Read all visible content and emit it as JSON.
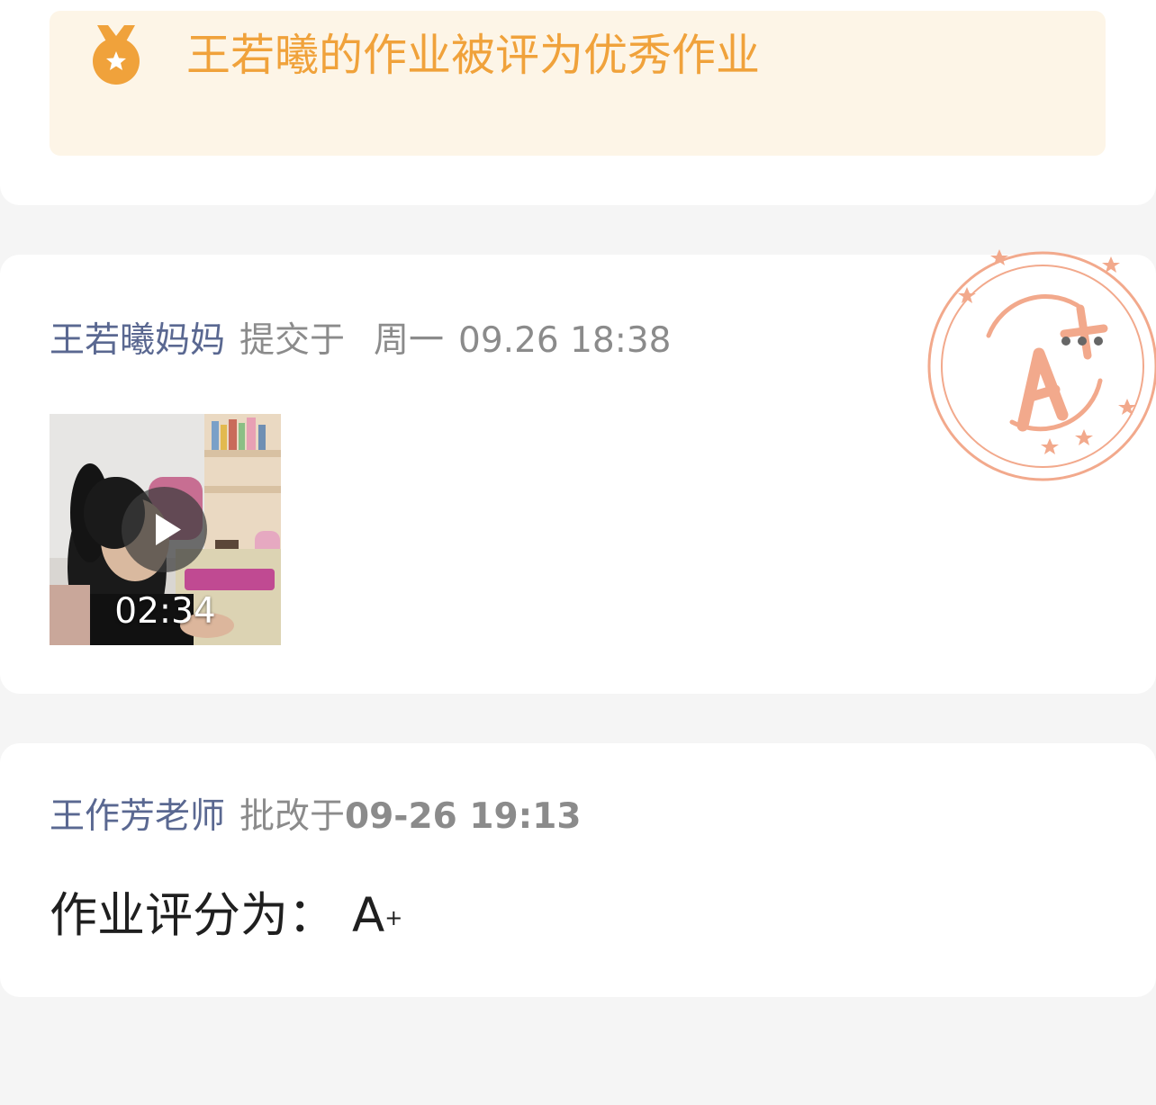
{
  "colors": {
    "page_bg": "#f5f5f5",
    "card_bg": "#ffffff",
    "banner_bg": "#fdf5e7",
    "accent_orange": "#f0a23b",
    "name_blue": "#5a6891",
    "muted_gray": "#8b8b8b",
    "stamp_salmon": "#f2a98c"
  },
  "banner": {
    "icon": "medal-icon",
    "text": "王若曦的作业被评为优秀作业"
  },
  "submission": {
    "submitter": "王若曦妈妈",
    "action": "提交于",
    "weekday": "周一",
    "datetime": "09.26 18:38",
    "stamp_grade": "A+",
    "more_icon": "more-dots-icon",
    "video": {
      "duration": "02:34",
      "play_icon": "play-icon"
    }
  },
  "review": {
    "reviewer": "王作芳老师",
    "action": "批改于",
    "datetime": "09-26 19:13",
    "score_label": "作业评分为：",
    "grade_letter": "A",
    "grade_sup": "+"
  }
}
